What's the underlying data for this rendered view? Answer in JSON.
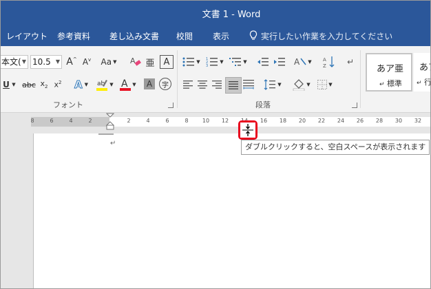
{
  "window": {
    "title": "文書 1 - Word"
  },
  "tabs": [
    {
      "label": "レイアウト"
    },
    {
      "label": "参考資料"
    },
    {
      "label": "差し込み文書"
    },
    {
      "label": "校閲"
    },
    {
      "label": "表示"
    }
  ],
  "tell_me": {
    "text": "実行したい作業を入力してください"
  },
  "font": {
    "name": "本文(",
    "size": "10.5",
    "group_label": "フォント",
    "case_label": "Aa",
    "enclose_char": "字",
    "ruby_char": "亜",
    "highlight_color": "#ffee00",
    "font_color": "#e81123"
  },
  "paragraph": {
    "group_label": "段落"
  },
  "styles": [
    {
      "sample": "あア亜",
      "name": "標準",
      "mark": "↵"
    },
    {
      "sample": "あア",
      "name": "行",
      "mark": "↵"
    }
  ],
  "ruler": {
    "left_ticks": [
      "8",
      "6",
      "4",
      "2"
    ],
    "right_ticks": [
      "2",
      "4",
      "6",
      "8",
      "10",
      "12",
      "14",
      "16",
      "18",
      "20",
      "22",
      "24",
      "26",
      "28",
      "30",
      "32"
    ]
  },
  "document": {
    "paragraph_mark": "↵"
  },
  "tooltip": {
    "text": "ダブルクリックすると、空白スペースが表示されます"
  },
  "colors": {
    "brand": "#2b579a",
    "highlight": "#e8001c"
  }
}
